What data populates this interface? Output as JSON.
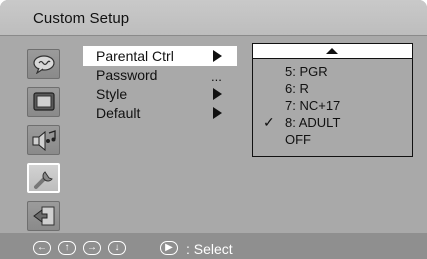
{
  "header": {
    "title": "Custom Setup"
  },
  "sidebar": {
    "icons": [
      {
        "name": "speech-bubble-icon",
        "selected": false
      },
      {
        "name": "tv-screen-icon",
        "selected": false
      },
      {
        "name": "speaker-music-icon",
        "selected": false
      },
      {
        "name": "wrench-icon",
        "selected": true
      },
      {
        "name": "exit-icon",
        "selected": false
      }
    ]
  },
  "menu": {
    "items": [
      {
        "label": "Parental Ctrl",
        "indicator": "arrow",
        "selected": true
      },
      {
        "label": "Password",
        "indicator": "..."
      },
      {
        "label": "Style",
        "indicator": "arrow"
      },
      {
        "label": "Default",
        "indicator": "arrow"
      }
    ]
  },
  "options": {
    "scroll_indicator": "up-arrow",
    "items": [
      {
        "label": "5: PGR",
        "checked": false
      },
      {
        "label": "6: R",
        "checked": false
      },
      {
        "label": "7: NC+17",
        "checked": false
      },
      {
        "label": "8: ADULT",
        "checked": true
      },
      {
        "label": "OFF",
        "checked": false
      }
    ],
    "check_mark": "✓"
  },
  "footer": {
    "buttons": [
      "left-arrow-icon",
      "up-arrow-icon",
      "right-arrow-icon",
      "down-arrow-icon",
      "play-icon"
    ],
    "arrows": {
      "left": "←",
      "up": "↑",
      "right": "→",
      "down": "↓",
      "play": "▶"
    },
    "hint": ": Select"
  },
  "colors": {
    "background": "#a9a9a9",
    "highlight": "#ffffff",
    "text": "#111111"
  }
}
